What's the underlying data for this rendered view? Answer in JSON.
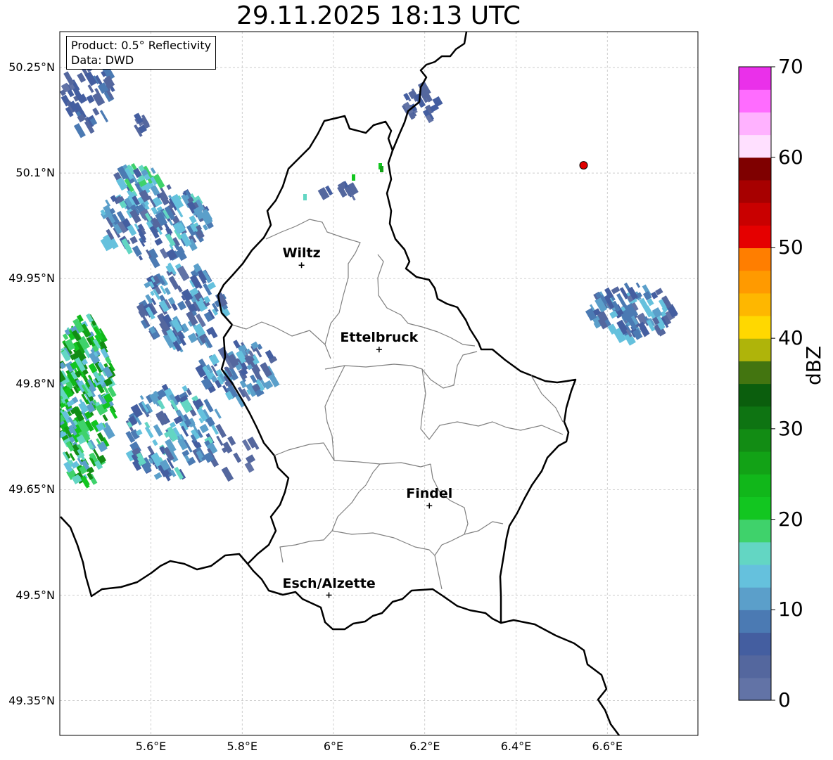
{
  "title": "29.11.2025 18:13 UTC",
  "info_box": {
    "product": "Product: 0.5° Reflectivity",
    "data": "Data: DWD"
  },
  "axes": {
    "lat_ticks": [
      "50.25°N",
      "50.1°N",
      "49.95°N",
      "49.8°N",
      "49.65°N",
      "49.5°N",
      "49.35°N"
    ],
    "lon_ticks": [
      "5.6°E",
      "5.8°E",
      "6°E",
      "6.2°E",
      "6.4°E",
      "6.6°E"
    ],
    "lat_range": [
      49.3,
      50.3
    ],
    "lon_range": [
      5.4,
      6.8
    ],
    "grid": true
  },
  "cities": [
    {
      "name": "Wiltz",
      "lon": 5.93,
      "lat": 49.969
    },
    {
      "name": "Ettelbruck",
      "lon": 6.1,
      "lat": 49.849
    },
    {
      "name": "Findel",
      "lon": 6.21,
      "lat": 49.627
    },
    {
      "name": "Esch/Alzette",
      "lon": 5.99,
      "lat": 49.5
    }
  ],
  "radar_site": {
    "lon": 6.548,
    "lat": 50.111,
    "color": "#e00000"
  },
  "colorbar": {
    "label": "dBZ",
    "min": 0,
    "max": 70,
    "tick_labels": [
      "0",
      "10",
      "20",
      "30",
      "40",
      "50",
      "60",
      "70"
    ],
    "colors": [
      "#6273a6",
      "#54679e",
      "#445ea0",
      "#4b7ab3",
      "#5b9fca",
      "#65c1dd",
      "#63d6c3",
      "#3fd26b",
      "#12c620",
      "#11b71a",
      "#12a216",
      "#128c14",
      "#0e7412",
      "#0b5e0d",
      "#437510",
      "#afb40a",
      "#ffd800",
      "#feb700",
      "#ff9a00",
      "#ff7e00",
      "#e50000",
      "#c90000",
      "#a70000",
      "#7f0000",
      "#ffe0ff",
      "#ffb2ff",
      "#ff6cff",
      "#ea30ea"
    ]
  }
}
